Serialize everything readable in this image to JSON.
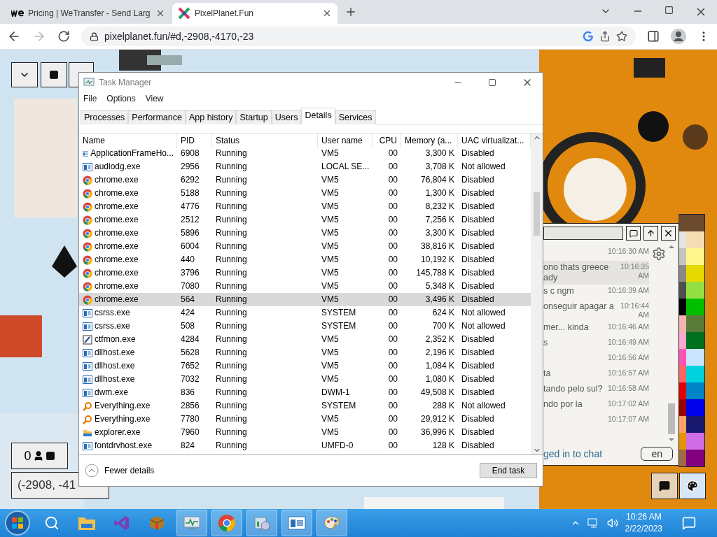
{
  "browser": {
    "tabs": [
      {
        "title": "Pricing | WeTransfer - Send Larg",
        "kind": "we",
        "selected": false
      },
      {
        "title": "PixelPlanet.Fun",
        "kind": "pixel",
        "selected": true
      }
    ],
    "url": "pixelplanet.fun/#d,-2908,-4170,-23"
  },
  "canvas": {
    "kind": "picture",
    "online_count": "0",
    "coordinates": "(-2908, -41"
  },
  "task_manager": {
    "title": "Task Manager",
    "menu": [
      "File",
      "Options",
      "View"
    ],
    "tabs": [
      {
        "label": "Processes",
        "selected": false
      },
      {
        "label": "Performance",
        "selected": false
      },
      {
        "label": "App history",
        "selected": false
      },
      {
        "label": "Startup",
        "selected": false
      },
      {
        "label": "Users",
        "selected": false
      },
      {
        "label": "Details",
        "selected": true
      },
      {
        "label": "Services",
        "selected": false
      }
    ],
    "columns": [
      "Name",
      "PID",
      "Status",
      "User name",
      "CPU",
      "Memory (a...",
      "UAC virtualizat..."
    ],
    "rows": [
      {
        "kind": "app",
        "name": "ApplicationFrameHo...",
        "pid": "6908",
        "status": "Running",
        "user": "VM5",
        "cpu": "00",
        "memory": "3,300 K",
        "uac": "Disabled",
        "selected": false
      },
      {
        "kind": "app",
        "name": "audiodg.exe",
        "pid": "2956",
        "status": "Running",
        "user": "LOCAL SE...",
        "cpu": "00",
        "memory": "3,708 K",
        "uac": "Not allowed",
        "selected": false
      },
      {
        "kind": "chrome",
        "name": "chrome.exe",
        "pid": "6292",
        "status": "Running",
        "user": "VM5",
        "cpu": "00",
        "memory": "76,804 K",
        "uac": "Disabled",
        "selected": false
      },
      {
        "kind": "chrome",
        "name": "chrome.exe",
        "pid": "5188",
        "status": "Running",
        "user": "VM5",
        "cpu": "00",
        "memory": "1,300 K",
        "uac": "Disabled",
        "selected": false
      },
      {
        "kind": "chrome",
        "name": "chrome.exe",
        "pid": "4776",
        "status": "Running",
        "user": "VM5",
        "cpu": "00",
        "memory": "8,232 K",
        "uac": "Disabled",
        "selected": false
      },
      {
        "kind": "chrome",
        "name": "chrome.exe",
        "pid": "2512",
        "status": "Running",
        "user": "VM5",
        "cpu": "00",
        "memory": "7,256 K",
        "uac": "Disabled",
        "selected": false
      },
      {
        "kind": "chrome",
        "name": "chrome.exe",
        "pid": "5896",
        "status": "Running",
        "user": "VM5",
        "cpu": "00",
        "memory": "3,300 K",
        "uac": "Disabled",
        "selected": false
      },
      {
        "kind": "chrome",
        "name": "chrome.exe",
        "pid": "6004",
        "status": "Running",
        "user": "VM5",
        "cpu": "00",
        "memory": "38,816 K",
        "uac": "Disabled",
        "selected": false
      },
      {
        "kind": "chrome",
        "name": "chrome.exe",
        "pid": "440",
        "status": "Running",
        "user": "VM5",
        "cpu": "00",
        "memory": "10,192 K",
        "uac": "Disabled",
        "selected": false
      },
      {
        "kind": "chrome",
        "name": "chrome.exe",
        "pid": "3796",
        "status": "Running",
        "user": "VM5",
        "cpu": "00",
        "memory": "145,788 K",
        "uac": "Disabled",
        "selected": false
      },
      {
        "kind": "chrome",
        "name": "chrome.exe",
        "pid": "7080",
        "status": "Running",
        "user": "VM5",
        "cpu": "00",
        "memory": "5,348 K",
        "uac": "Disabled",
        "selected": false
      },
      {
        "kind": "chrome",
        "name": "chrome.exe",
        "pid": "564",
        "status": "Running",
        "user": "VM5",
        "cpu": "00",
        "memory": "3,496 K",
        "uac": "Disabled",
        "selected": true
      },
      {
        "kind": "app",
        "name": "csrss.exe",
        "pid": "424",
        "status": "Running",
        "user": "SYSTEM",
        "cpu": "00",
        "memory": "624 K",
        "uac": "Not allowed",
        "selected": false
      },
      {
        "kind": "app",
        "name": "csrss.exe",
        "pid": "508",
        "status": "Running",
        "user": "SYSTEM",
        "cpu": "00",
        "memory": "700 K",
        "uac": "Not allowed",
        "selected": false
      },
      {
        "kind": "pen",
        "name": "ctfmon.exe",
        "pid": "4284",
        "status": "Running",
        "user": "VM5",
        "cpu": "00",
        "memory": "2,352 K",
        "uac": "Disabled",
        "selected": false
      },
      {
        "kind": "app",
        "name": "dllhost.exe",
        "pid": "5628",
        "status": "Running",
        "user": "VM5",
        "cpu": "00",
        "memory": "2,196 K",
        "uac": "Disabled",
        "selected": false
      },
      {
        "kind": "app",
        "name": "dllhost.exe",
        "pid": "7652",
        "status": "Running",
        "user": "VM5",
        "cpu": "00",
        "memory": "1,084 K",
        "uac": "Disabled",
        "selected": false
      },
      {
        "kind": "app",
        "name": "dllhost.exe",
        "pid": "7032",
        "status": "Running",
        "user": "VM5",
        "cpu": "00",
        "memory": "1,080 K",
        "uac": "Disabled",
        "selected": false
      },
      {
        "kind": "app",
        "name": "dwm.exe",
        "pid": "836",
        "status": "Running",
        "user": "DWM-1",
        "cpu": "00",
        "memory": "49,508 K",
        "uac": "Disabled",
        "selected": false
      },
      {
        "kind": "search",
        "name": "Everything.exe",
        "pid": "2856",
        "status": "Running",
        "user": "SYSTEM",
        "cpu": "00",
        "memory": "288 K",
        "uac": "Not allowed",
        "selected": false
      },
      {
        "kind": "search",
        "name": "Everything.exe",
        "pid": "7780",
        "status": "Running",
        "user": "VM5",
        "cpu": "00",
        "memory": "29,912 K",
        "uac": "Disabled",
        "selected": false
      },
      {
        "kind": "folder",
        "name": "explorer.exe",
        "pid": "7960",
        "status": "Running",
        "user": "VM5",
        "cpu": "00",
        "memory": "36,996 K",
        "uac": "Disabled",
        "selected": false
      },
      {
        "kind": "app",
        "name": "fontdrvhost.exe",
        "pid": "824",
        "status": "Running",
        "user": "UMFD-0",
        "cpu": "00",
        "memory": "128 K",
        "uac": "Disabled",
        "selected": false
      }
    ],
    "fewer_details": "Fewer details",
    "end_task": "End task"
  },
  "chat": {
    "messages": [
      {
        "time": "10:16:30 AM",
        "highlighted": false
      },
      {
        "text": "ono thats greece\nady",
        "time": "10:16:35 AM",
        "highlighted": true
      },
      {
        "text": "s c ngm",
        "time": "10:16:39 AM",
        "highlighted": false
      },
      {
        "text": "onseguir apagar a",
        "time": "10:16:44 AM",
        "highlighted": false
      },
      {
        "text": "mer... kinda",
        "time": "10:16:46 AM",
        "highlighted": false
      },
      {
        "text": "s",
        "time": "10:16:49 AM",
        "highlighted": false
      },
      {
        "time": "10:16:56 AM",
        "highlighted": false
      },
      {
        "text": "ta",
        "time": "10:16:57 AM",
        "highlighted": false
      },
      {
        "text": "tando pelo sul?",
        "time": "10:16:58 AM",
        "highlighted": false
      },
      {
        "text": "ndo por la",
        "time": "10:17:02 AM",
        "highlighted": false
      },
      {
        "time": "10:17:07 AM",
        "highlighted": false
      }
    ],
    "status": "ged in to chat",
    "language": "en"
  },
  "palette": {
    "swatches": [
      {
        "color": "#6b4a2e"
      },
      {
        "color": "#6b4a2e"
      },
      {
        "color": "#e4e4e4"
      },
      {
        "color": "#f5deb3"
      },
      {
        "color": "#c4c4c4"
      },
      {
        "color": "#fff58a"
      },
      {
        "color": "#888888"
      },
      {
        "color": "#e5d900"
      },
      {
        "color": "#4e4e4e"
      },
      {
        "color": "#94e044"
      },
      {
        "color": "#000000"
      },
      {
        "color": "#02be01"
      },
      {
        "color": "#f4b3ae"
      },
      {
        "color": "#5a7a3a"
      },
      {
        "color": "#ffa7d1"
      },
      {
        "color": "#006f1e"
      },
      {
        "color": "#ff54b2"
      },
      {
        "color": "#cae3ff"
      },
      {
        "color": "#ff6565"
      },
      {
        "color": "#00d3dd"
      },
      {
        "color": "#e50000"
      },
      {
        "color": "#0083c7"
      },
      {
        "color": "#9a0000"
      },
      {
        "color": "#0000ea"
      },
      {
        "color": "#fea460"
      },
      {
        "color": "#191970"
      },
      {
        "color": "#e59500"
      },
      {
        "color": "#cf6ee4"
      },
      {
        "color": "#a06a42"
      },
      {
        "color": "#820080"
      }
    ]
  },
  "taskbar": {
    "apps": [
      {
        "kind": "search",
        "running": false
      },
      {
        "kind": "folder",
        "running": false
      },
      {
        "kind": "studio",
        "running": false
      },
      {
        "kind": "box",
        "running": false
      },
      {
        "kind": "monitor",
        "running": true
      },
      {
        "kind": "chrome",
        "running": true
      },
      {
        "kind": "media",
        "running": true
      },
      {
        "kind": "window",
        "running": true
      },
      {
        "kind": "paint",
        "running": true
      }
    ],
    "time": "10:26 AM",
    "date": "2/22/2023"
  }
}
